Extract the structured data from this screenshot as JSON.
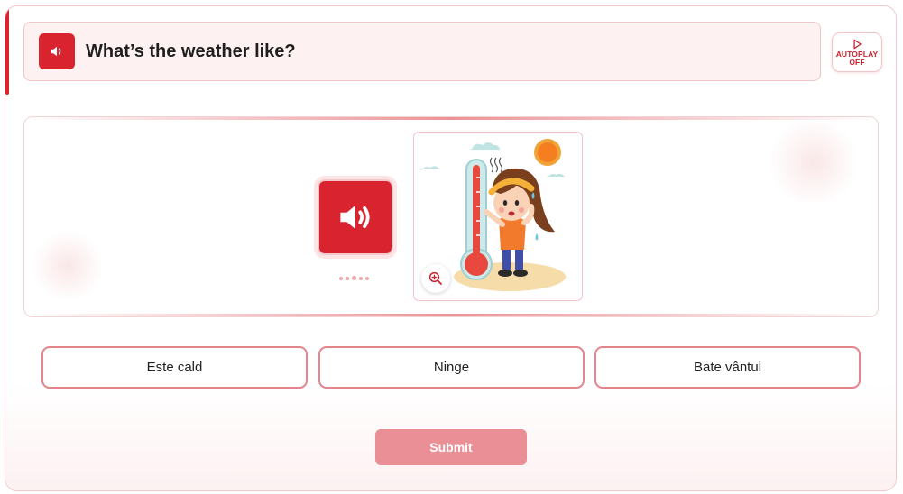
{
  "question": {
    "title": "What’s the weather like?",
    "audio_icon": "speaker-icon"
  },
  "autoplay": {
    "label": "AUTOPLAY",
    "state": "OFF",
    "icon": "play-outline-icon"
  },
  "stage": {
    "audio_icon": "speaker-icon",
    "image_description_icon": "hot-weather-illustration",
    "zoom_icon": "zoom-in-icon"
  },
  "options": [
    {
      "label": "Este cald"
    },
    {
      "label": "Ninge"
    },
    {
      "label": "Bate vântul"
    }
  ],
  "submit": {
    "label": "Submit"
  },
  "colors": {
    "accent": "#d9232e",
    "option_border": "#e4848b",
    "submit_bg": "#ea8f95",
    "header_bg": "#fdf1f1"
  }
}
